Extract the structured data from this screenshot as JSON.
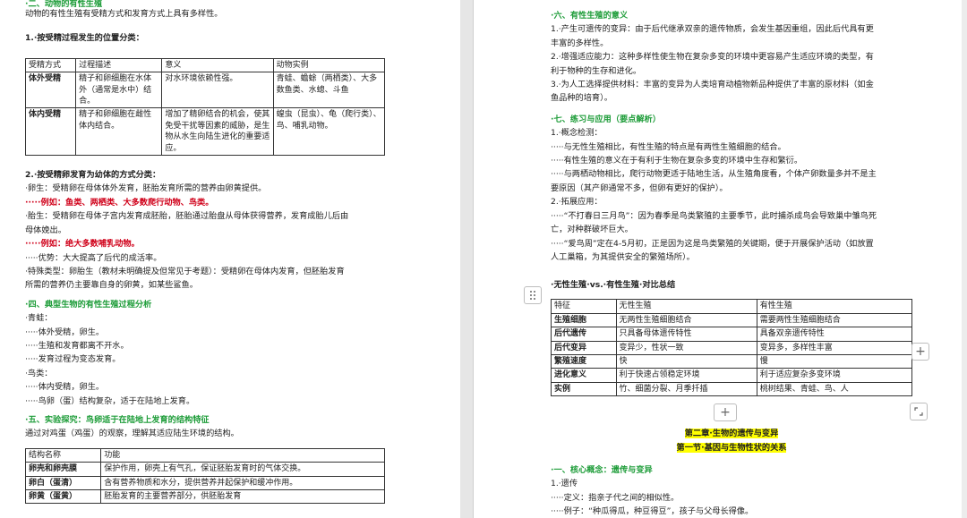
{
  "left": {
    "top_partial": "·二、动物的有性生殖",
    "intro": "动物的有性生殖有受精方式和发育方式上具有多样性。",
    "s1_title": "1.·按受精过程发生的位置分类：",
    "table1": {
      "headers": [
        "受精方式",
        "过程描述",
        "意义",
        "动物实例"
      ],
      "rows": [
        [
          "体外受精",
          "精子和卵细胞在水体外（通常是水中）结合。",
          "对水环境依赖性强。",
          "青蛙、蟾蜍（两栖类）、大多数鱼类、水螅、斗鱼"
        ],
        [
          "体内受精",
          "精子和卵细胞在雌性体内结合。",
          "增加了精卵结合的机会，使其免受干扰等因素的威胁，是生物从水生向陆生进化的重要适应。",
          "蝗虫（昆虫）、龟（爬行类）、鸟、哺乳动物。"
        ]
      ]
    },
    "s2_title": "2.·按受精卵发育为幼体的方式分类：",
    "s2_lines": [
      "·卵生：受精卵在母体体外发育，胚胎发育所需的营养由卵黄提供。",
      "·····例如：鱼类、两栖类、大多数爬行动物、鸟类。",
      "·胎生：受精卵在母体子宫内发育成胚胎，胚胎通过胎盘从母体获得营养，发育成胎儿后由",
      "母体娩出。",
      "·····例如：绝大多数哺乳动物。",
      "·····优势：大大提高了后代的成活率。",
      "·特殊类型：卵胎生（教材未明确提及但常见于考题）：受精卵在母体内发育，但胚胎发育",
      "所需的营养仍主要靠自身的卵黄，如某些鲨鱼。"
    ],
    "s4_title": "·四、典型生物的有性生殖过程分析",
    "s4_lines": [
      "·青蛙：",
      "·····体外受精，卵生。",
      "·····生殖和发育都离不开水。",
      "·····发育过程为变态发育。",
      "·鸟类：",
      "·····体内受精，卵生。",
      "·····鸟卵（蛋）结构复杂，适于在陆地上发育。"
    ],
    "s5_title": "·五、实验探究：鸟卵适于在陆地上发育的结构特征",
    "s5_intro": "通过对鸡蛋（鸡蛋）的观察，理解其适应陆生环境的结构。",
    "table2": {
      "headers": [
        "结构名称",
        "功能"
      ],
      "rows": [
        [
          "卵壳和卵壳膜",
          "保护作用，卵壳上有气孔，保证胚胎发育时的气体交换。"
        ],
        [
          "卵白（蛋清）",
          "含有营养物质和水分，提供营养并起保护和缓冲作用。"
        ],
        [
          "卵黄（蛋黄）",
          "胚胎发育的主要营养部分，供胚胎发育"
        ]
      ]
    }
  },
  "right": {
    "s6_title": "·六、有性生殖的意义",
    "s6_lines": [
      "1.·产生可遗传的变异：由于后代继承双亲的遗传物质，会发生基因重组，因此后代具有更",
      "丰富的多样性。",
      "2.·增强适应能力：这种多样性使生物在复杂多变的环境中更容易产生适应环境的类型，有",
      "利于物种的生存和进化。",
      "3.·为人工选择提供材料：丰富的变异为人类培育动植物新品种提供了丰富的原材料（如金",
      "鱼品种的培育）。"
    ],
    "s7_title": "·七、练习与应用（要点解析）",
    "s7_lines": [
      "1.·概念检测：",
      "·····与无性生殖相比，有性生殖的特点是有两性生殖细胞的结合。",
      "·····有性生殖的意义在于有利于生物在复杂多变的环境中生存和繁衍。",
      "·····与两栖动物相比，爬行动物更适于陆地生活，从生殖角度看，个体产卵数量多并不是主",
      "要原因（其产卵通常不多，但卵有更好的保护）。",
      "2.·拓展应用：",
      "·····“不打春日三月鸟”：因为春季是鸟类繁殖的主要季节，此时捕杀成鸟会导致巢中雏鸟死",
      "亡，对种群破坏巨大。",
      "·····“爱鸟周”定在4-5月初，正是因为这是鸟类繁殖的关键期，便于开展保护活动（如放置",
      "人工巢箱，为其提供安全的繁殖场所）。"
    ],
    "table3_caption": "·无性生殖·vs.·有性生殖·对比总结",
    "table3": {
      "headers": [
        "特征",
        "无性生殖",
        "有性生殖"
      ],
      "rows": [
        [
          "生殖细胞",
          "无两性生殖细胞结合",
          "需要两性生殖细胞结合"
        ],
        [
          "后代遗传",
          "只具备母体遗传特性",
          "具备双亲遗传特性"
        ],
        [
          "后代变异",
          "变异少，性状一致",
          "变异多，多样性丰富"
        ],
        [
          "繁殖速度",
          "快",
          "慢"
        ],
        [
          "进化意义",
          "利于快速占领稳定环境",
          "利于适应复杂多变环境"
        ],
        [
          "实例",
          "竹、细菌分裂、月季扦插",
          "桃树结果、青蛙、鸟、人"
        ]
      ]
    },
    "chapter_title": "第二章·生物的遗传与变异",
    "section_title": "第一节·基因与生物性状的关系",
    "s8_title": "·一、核心概念：遗传与变异",
    "s8_lines": [
      "1.·遗传",
      "·····定义：指亲子代之间的相似性。",
      "·····例子：“种瓜得瓜，种豆得豆”，孩子与父母长得像。"
    ]
  },
  "ui": {
    "add_icon": "plus-icon",
    "drag_icon": "drag-handle-icon",
    "expand_icon": "expand-corner-icon"
  }
}
